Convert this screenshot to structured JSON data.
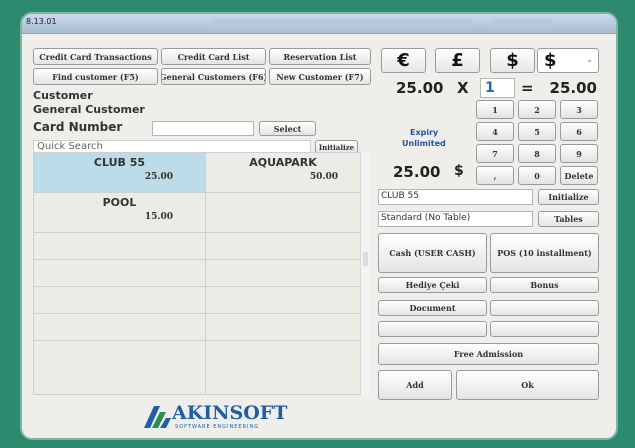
{
  "window": {
    "title": "8.13.01"
  },
  "toolbar": {
    "credit_card_transactions": "Credit Card Transactions",
    "credit_card_list": "Credit Card List",
    "reservation_list": "Reservation List",
    "find_customer": "Find customer (F5)",
    "general_customers": "General Customers (F6)",
    "new_customer": "New Customer (F7)"
  },
  "customer": {
    "heading": "Customer",
    "name": "General Customer",
    "card_number_label": "Card Number",
    "card_number_value": "",
    "select_label": "Select",
    "quick_search_label": "Quick Search",
    "quick_search_value": "",
    "initialize_label": "Initialize"
  },
  "products": [
    {
      "name": "CLUB 55",
      "price": "25.00",
      "selected": true
    },
    {
      "name": "AQUAPARK",
      "price": "50.00",
      "selected": false
    },
    {
      "name": "POOL",
      "price": "15.00",
      "selected": false
    }
  ],
  "currency": {
    "symbols": [
      "€",
      "£",
      "$",
      "$"
    ],
    "colors": {
      "selected_cell": "#bcdcea",
      "frame": "#2e8a6e"
    }
  },
  "calc": {
    "amount": "25.00",
    "times": "X",
    "quantity": "1",
    "equals": "=",
    "total": "25.00",
    "expiry_label": "Expiry",
    "expiry_value": "Unlimited",
    "price_display": "25.00",
    "price_currency": "$",
    "keys": [
      "1",
      "2",
      "3",
      "4",
      "5",
      "6",
      "7",
      "8",
      "9",
      ",",
      "0",
      "Delete"
    ]
  },
  "order": {
    "product_field": "CLUB 55",
    "initialize_label": "Initialize",
    "table_field": "Standard (No Table)",
    "tables_label": "Tables"
  },
  "payment": {
    "cash": "Cash (USER CASH)",
    "pos": "POS (10 installment)",
    "hediye": "Hediye Çeki",
    "bonus": "Bonus",
    "document": "Document",
    "free_admission": "Free Admission",
    "add": "Add",
    "ok": "Ok"
  },
  "brand": {
    "logo_text": "AKINSOFT",
    "tagline": "SOFTWARE ENGINEERING"
  }
}
